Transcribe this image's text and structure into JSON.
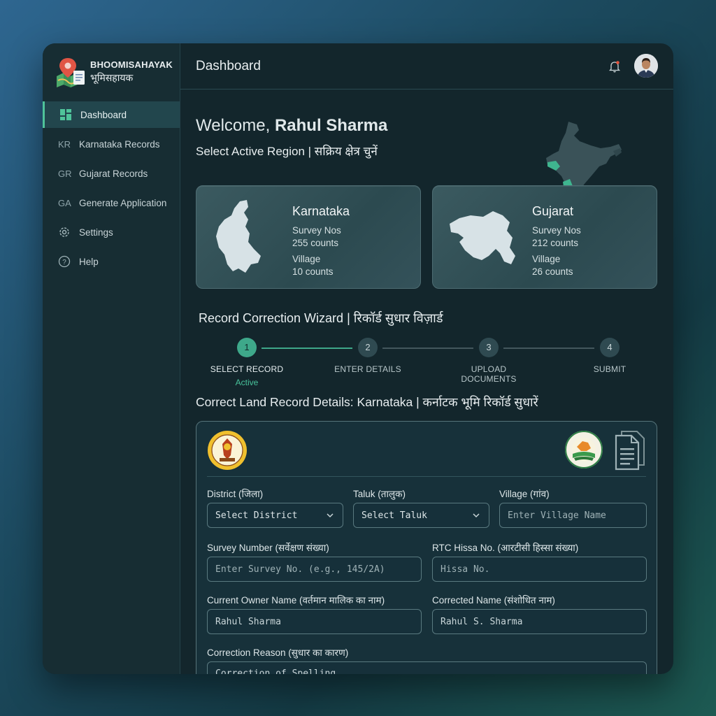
{
  "brand": {
    "name_en": "BHOOMISAHAYAK",
    "name_hi": "भूमिसहायक"
  },
  "sidebar": {
    "items": [
      {
        "icon": "grid-icon",
        "abbr": "",
        "label": "Dashboard",
        "active": true
      },
      {
        "icon": "",
        "abbr": "KR",
        "label": "Karnataka Records",
        "active": false
      },
      {
        "icon": "",
        "abbr": "GR",
        "label": "Gujarat Records",
        "active": false
      },
      {
        "icon": "",
        "abbr": "GA",
        "label": "Generate Application",
        "active": false
      },
      {
        "icon": "gear-icon",
        "abbr": "",
        "label": "Settings",
        "active": false
      },
      {
        "icon": "help-icon",
        "abbr": "",
        "label": "Help",
        "active": false
      }
    ]
  },
  "header": {
    "title": "Dashboard"
  },
  "welcome": {
    "prefix": "Welcome,",
    "name": "Rahul Sharma",
    "region_prompt": "Select Active Region | सक्रिय क्षेत्र चुनें"
  },
  "region_cards": [
    {
      "title": "Karnataka",
      "survey_label": "Survey Nos",
      "survey_value": "255 counts",
      "village_label": "Village",
      "village_value": "10 counts"
    },
    {
      "title": "Gujarat",
      "survey_label": "Survey Nos",
      "survey_value": "212 counts",
      "village_label": "Village",
      "village_value": "26 counts"
    }
  ],
  "wizard": {
    "title": "Record Correction Wizard | रिकॉर्ड सुधार विज़ार्ड",
    "steps": [
      {
        "number": "1",
        "label": "SELECT RECORD",
        "status": "Active"
      },
      {
        "number": "2",
        "label": "ENTER DETAILS",
        "status": ""
      },
      {
        "number": "3",
        "label": "UPLOAD DOCUMENTS",
        "status": ""
      },
      {
        "number": "4",
        "label": "SUBMIT",
        "status": ""
      }
    ]
  },
  "form": {
    "title": "Correct Land Record Details: Karnataka | कर्नाटक भूमि रिकॉर्ड सुधारें",
    "district": {
      "label": "District (जिला)",
      "value": "Select District"
    },
    "taluk": {
      "label": "Taluk (तालुक)",
      "value": "Select Taluk"
    },
    "village": {
      "label": "Village (गांव)",
      "placeholder": "Enter Village Name"
    },
    "survey_number": {
      "label": "Survey Number (सर्वेक्षण संख्या)",
      "placeholder": "Enter Survey No. (e.g., 145/2A)"
    },
    "rtc_hissa": {
      "label": "RTC Hissa No. (आरटीसी हिस्सा संख्या)",
      "placeholder": "Hissa No."
    },
    "current_owner": {
      "label": "Current Owner Name (वर्तमान मालिक का नाम)",
      "value": "Rahul Sharma"
    },
    "corrected_name": {
      "label": "Corrected Name (संशोधित नाम)",
      "value": "Rahul S. Sharma"
    },
    "correction_reason": {
      "label": "Correction Reason (सुधार का कारण)",
      "value": "Correction of Spelling"
    }
  },
  "colors": {
    "accent": "#3ea88a",
    "background": "#13262c",
    "sidebar": "#172d33",
    "map_highlight": "#3fb58f"
  }
}
